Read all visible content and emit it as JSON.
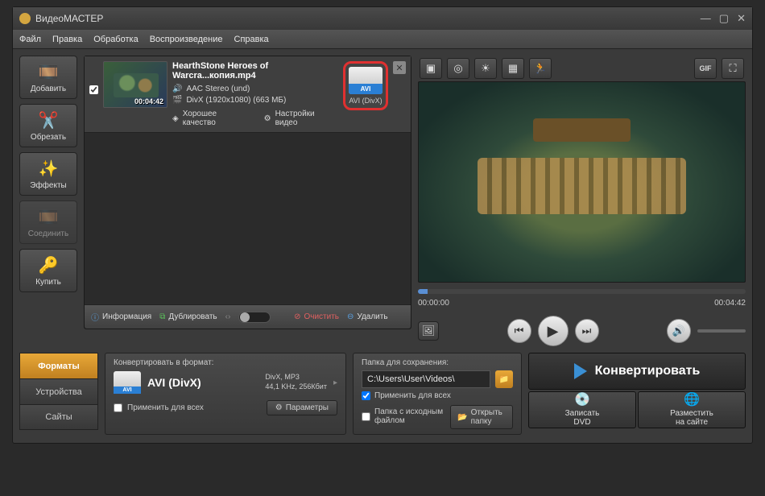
{
  "window": {
    "title": "ВидеоМАСТЕР"
  },
  "menu": {
    "file": "Файл",
    "edit": "Правка",
    "process": "Обработка",
    "playback": "Воспроизведение",
    "help": "Справка"
  },
  "sidebar": {
    "add": "Добавить",
    "cut": "Обрезать",
    "effects": "Эффекты",
    "join": "Соединить",
    "buy": "Купить"
  },
  "file": {
    "name": "HearthStone  Heroes of Warcra...копия.mp4",
    "audio": "AAC Stereo (und)",
    "video": "DivX (1920x1080) (663 МБ)",
    "quality": "Хорошее качество",
    "settings": "Настройки видео",
    "duration": "00:04:42",
    "fmt_tag": "AVI",
    "fmt_label": "AVI (DivX)"
  },
  "listfooter": {
    "info": "Информация",
    "dup": "Дублировать",
    "clear": "Очистить",
    "del": "Удалить"
  },
  "preview": {
    "start": "00:00:00",
    "end": "00:04:42"
  },
  "tabs": {
    "formats": "Форматы",
    "devices": "Устройства",
    "sites": "Сайты"
  },
  "format_panel": {
    "title": "Конвертировать в формат:",
    "name": "AVI (DivX)",
    "tag": "AVI",
    "det1": "DivX, MP3",
    "det2": "44,1 KHz, 256Кбит",
    "apply_all": "Применить для всех",
    "params": "Параметры"
  },
  "save_panel": {
    "title": "Папка для сохранения:",
    "path": "C:\\Users\\User\\Videos\\",
    "apply_all": "Применить для всех",
    "with_source": "Папка с исходным файлом",
    "open": "Открыть папку"
  },
  "actions": {
    "convert": "Конвертировать",
    "dvd1": "Записать",
    "dvd2": "DVD",
    "web1": "Разместить",
    "web2": "на сайте"
  }
}
